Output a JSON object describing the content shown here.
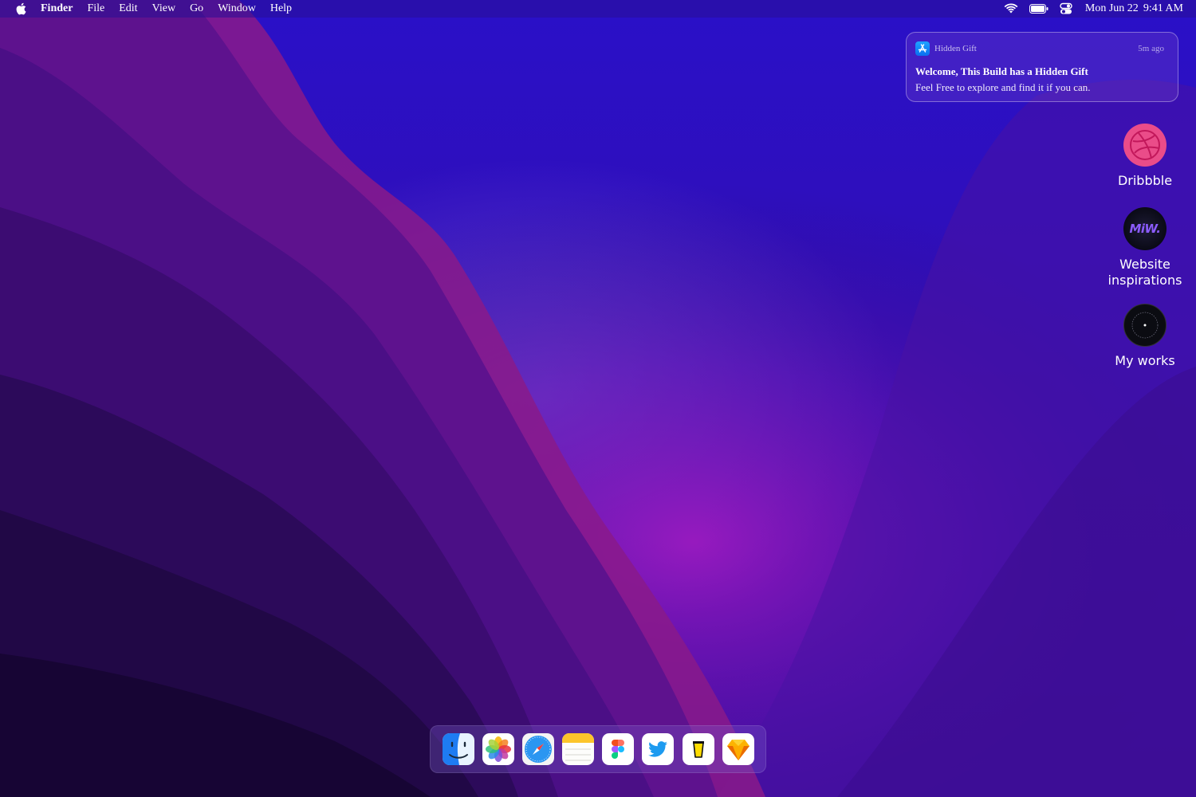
{
  "menubar": {
    "app_name": "Finder",
    "items": [
      "File",
      "Edit",
      "View",
      "Go",
      "Window",
      "Help"
    ],
    "date": "Mon Jun 22",
    "time": "9:41 AM"
  },
  "notification": {
    "app_name": "Hidden Gift",
    "time_ago": "5m ago",
    "title": "Welcome, This Build has a Hidden Gift",
    "body": "Feel Free to explore and find it if you can."
  },
  "desktop_icons": [
    {
      "label": "Dribbble"
    },
    {
      "label": "Website inspirations",
      "logo_text": "MiW."
    },
    {
      "label": "My works"
    }
  ],
  "dock": {
    "apps": [
      "finder-icon",
      "photos-icon",
      "safari-icon",
      "notes-icon",
      "figma-icon",
      "twitter-icon",
      "buy-me-a-coffee-icon",
      "sketch-icon"
    ]
  }
}
